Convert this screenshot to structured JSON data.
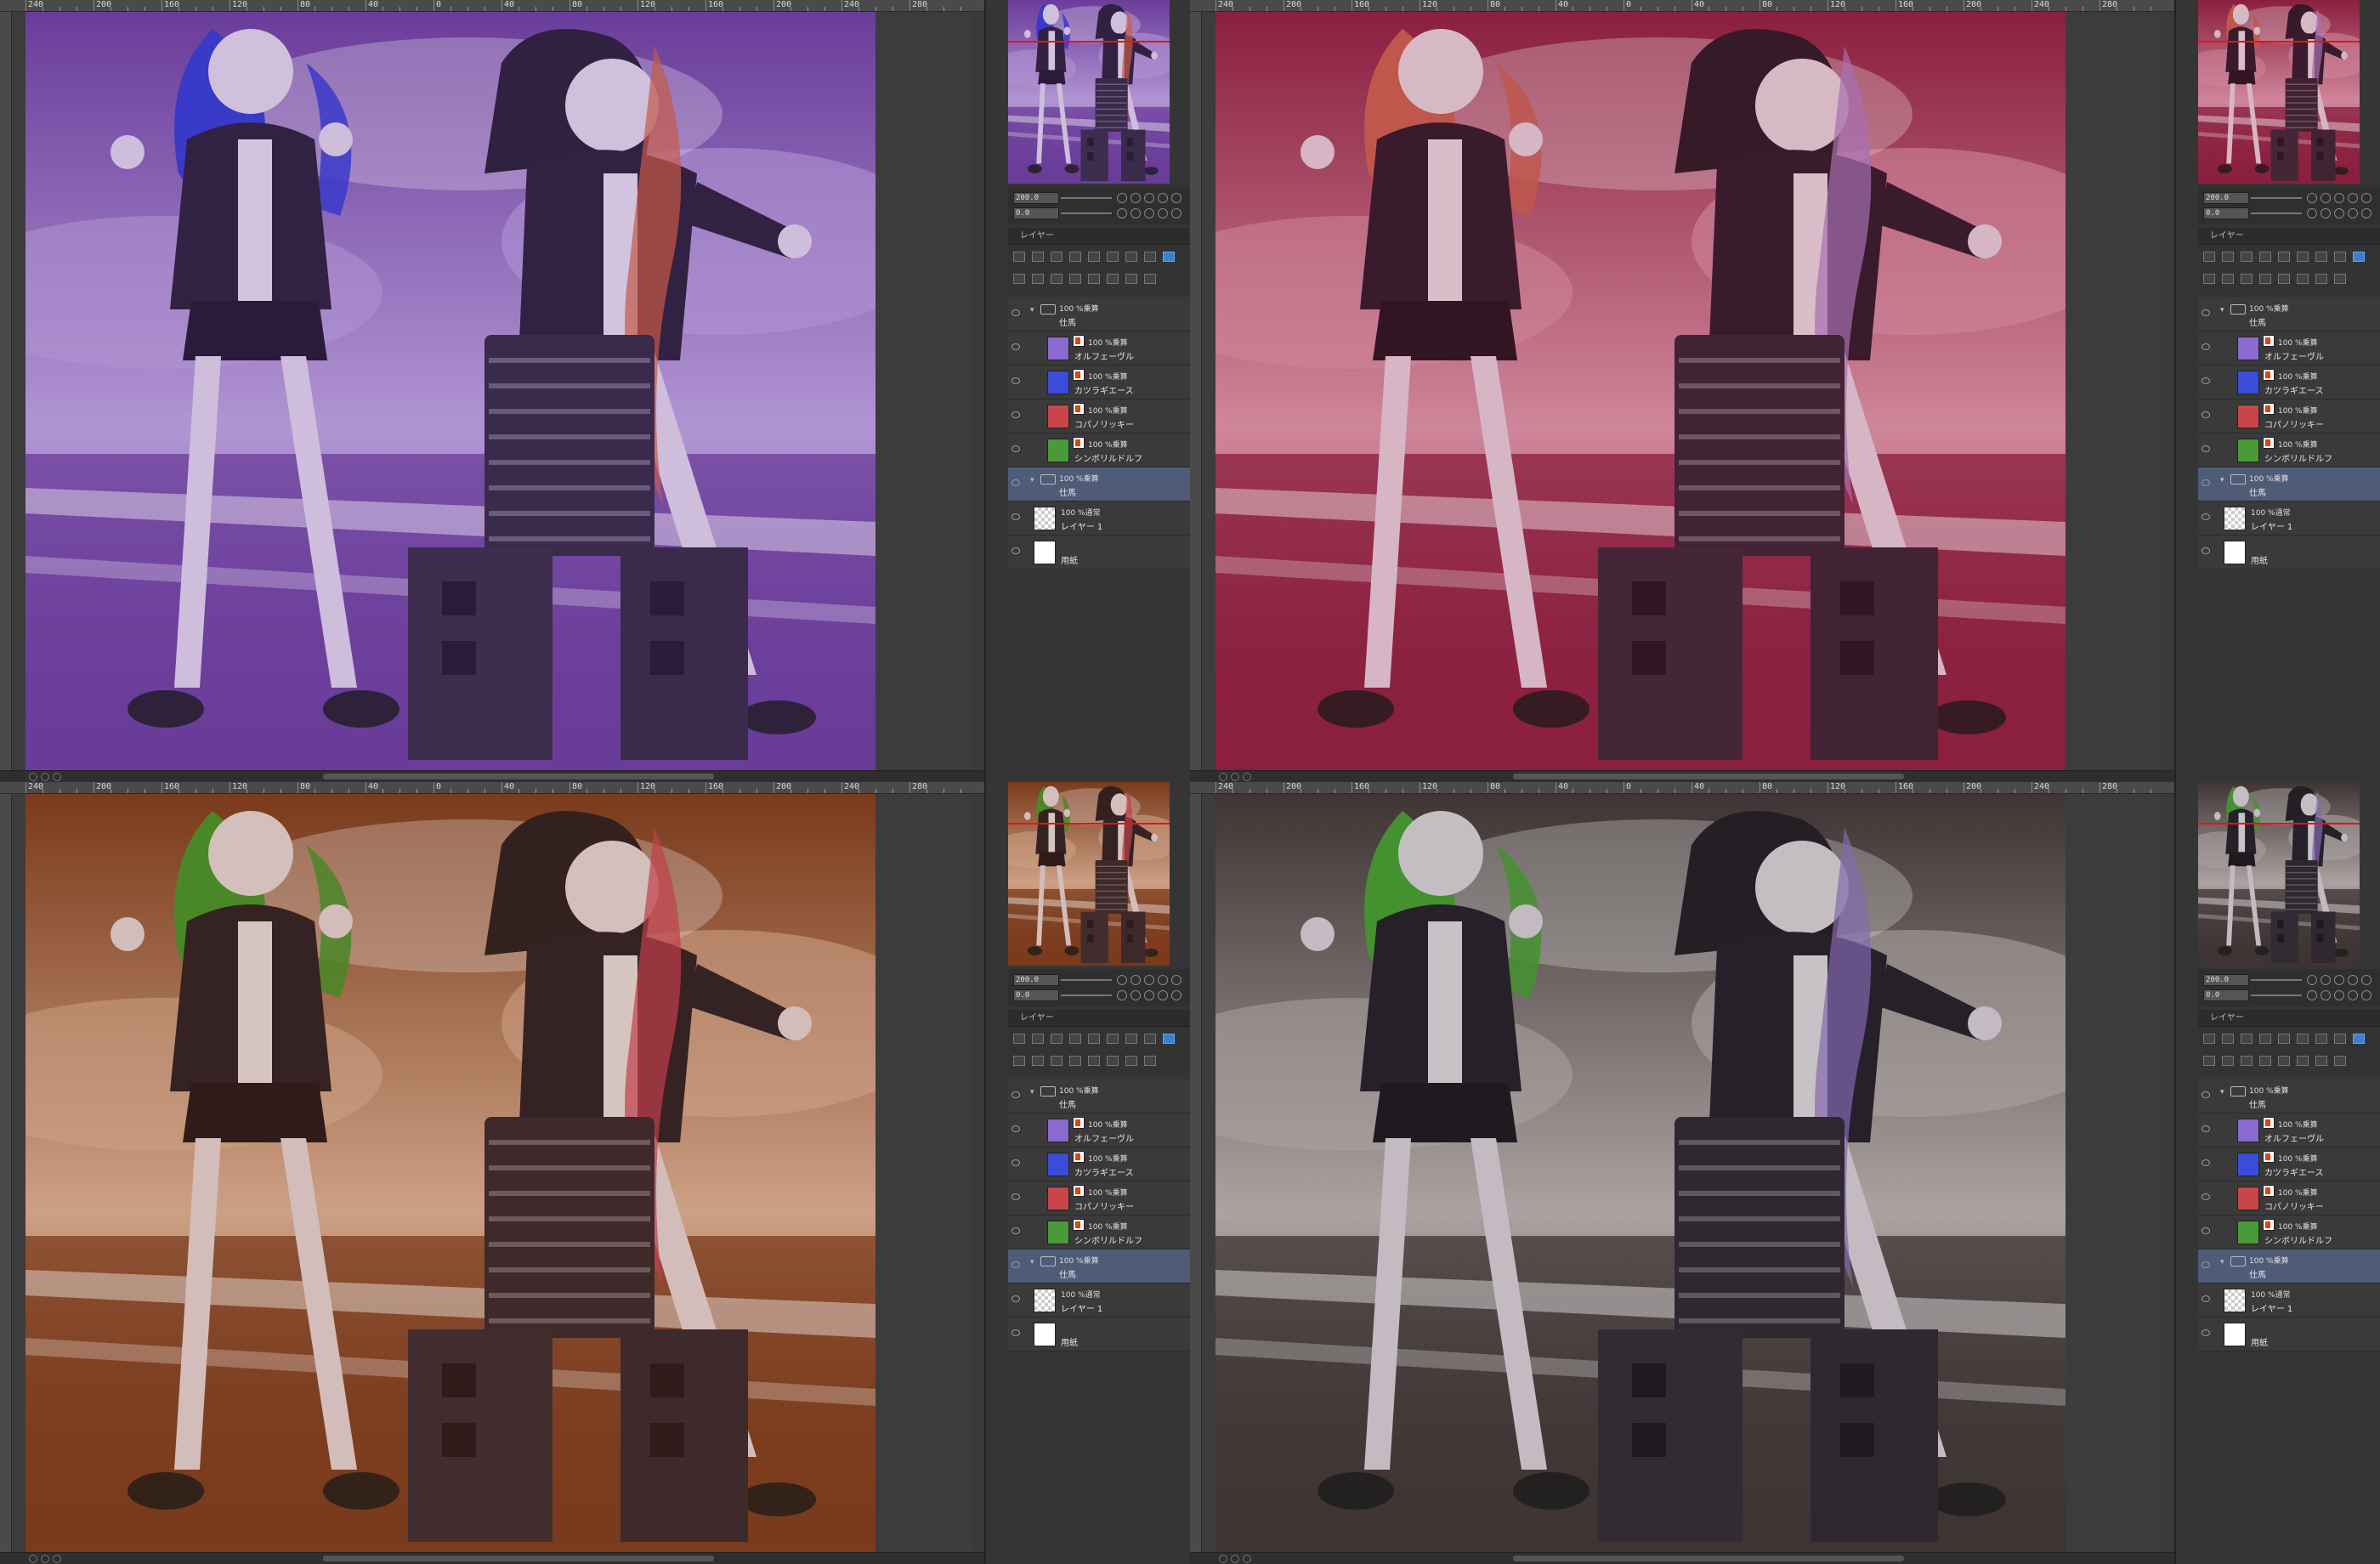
{
  "ruler": {
    "labels": [
      "240",
      "200",
      "160",
      "120",
      "80",
      "40",
      "0",
      "40",
      "80",
      "120",
      "160",
      "200",
      "240",
      "280"
    ]
  },
  "navigator": {
    "zoom": "200.0",
    "rotation": "0.0"
  },
  "layer_panel": {
    "tab_label": "レイヤー",
    "layers": [
      {
        "blend": "100 %乗算",
        "name": "仕馬",
        "type": "folder",
        "indent": 0
      },
      {
        "blend": "100 %乗算",
        "name": "オルフェーヴル",
        "type": "layer",
        "indent": 1,
        "swatch": "#8a6ad0"
      },
      {
        "blend": "100 %乗算",
        "name": "カツラギエース",
        "type": "layer",
        "indent": 1,
        "swatch": "#3a4cd8"
      },
      {
        "blend": "100 %乗算",
        "name": "コパノリッキー",
        "type": "layer",
        "indent": 1,
        "swatch": "#c8454a"
      },
      {
        "blend": "100 %乗算",
        "name": "シンボリルドルフ",
        "type": "layer",
        "indent": 1,
        "swatch": "#4a9a3a"
      },
      {
        "blend": "100 %乗算",
        "name": "仕馬",
        "type": "folder",
        "indent": 0,
        "selected": true
      },
      {
        "blend": "100 %通常",
        "name": "レイヤー 1",
        "type": "layer",
        "indent": 0,
        "swatch": "checker"
      },
      {
        "blend": "",
        "name": "用紙",
        "type": "layer",
        "indent": 0,
        "swatch": "#ffffff"
      }
    ]
  },
  "windows": [
    {
      "tint": "#6a3d9a",
      "tint_light": "#c8b3e6",
      "hair": "#2a3ad8",
      "accent": "#e2642c"
    },
    {
      "tint": "#8a1f3e",
      "tint_light": "#e6a8ba",
      "hair": "#d06a50",
      "accent": "#b08ad8"
    },
    {
      "tint": "#7a3a1c",
      "tint_light": "#e8c2a8",
      "hair": "#3aa02a",
      "accent": "#d8405a"
    },
    {
      "tint": "#3e3534",
      "tint_light": "#cfc7c6",
      "hair": "#46b02e",
      "accent": "#9a7ad8"
    }
  ]
}
